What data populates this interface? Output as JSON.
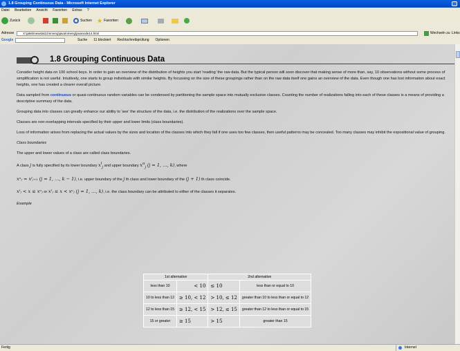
{
  "window": {
    "title": "1.8 Grouping Continuous Data - Microsoft Internet Explorer"
  },
  "menu": [
    "Datei",
    "Bearbeiten",
    "Ansicht",
    "Favoriten",
    "Extras",
    "?"
  ],
  "toolbar": {
    "back": "Zurück",
    "search": "Suchen",
    "favorites": "Favoriten"
  },
  "address": {
    "label": "Adresse",
    "url": "X:\\jaleb\\newstat11\\nmeng\\java\\nmeng\\javanode14.html",
    "go": "Wechseln zu",
    "links": "Links"
  },
  "google": {
    "logo": "Google",
    "search": "Suche",
    "blocked": "11 blockiert",
    "spell": "Rechtschreibprüfung",
    "options": "Optionen"
  },
  "page": {
    "title": "1.8 Grouping Continuous Data",
    "para1": "Consider height data on 100 school boys. In order to gain an overview of the distribution of heights you start 'reading' the raw data. But the typical person will soon discover that making sense of more than, say, 10 observations without some process of simplification is not useful. Intuitively, one starts to group individuals with similar heights. By focussing on the size of these groupings rather than on the raw data itself one gains an overview of the data. Even though one has lost information about exact heights, one has created a clearer overall picture.",
    "para2_pre": "Data sampled from ",
    "para2_link": "continuous",
    "para2_post": " or quasi-continuous random variables can be condensed by partitioning the sample space into mutually exclusive classes. Counting the number of realizations falling into each of these classes is a means of providing a descriptive summary of the data.",
    "para3": "Grouping data into classes can greatly enhance our ability to 'see' the structure of the data, i.e. the distribution of the realizations over the sample space.",
    "para4": "Classes are non-overlapping intervals specified by their upper and lower limits (class boundaries).",
    "para5": "Loss of information arises from replacing the actual values by the sizes and location of the classes into which they fall if one uses too few classes, then useful patterns may be concealed. Too many classes may inhibit the expositional value of grouping.",
    "heading_boundaries": "Class boundaries",
    "para6": "The upper and lower values of a class are called class boundaries.",
    "para7_a": "A class ",
    "para7_j": "j",
    "para7_b": " is fully specified by its lower boundary ",
    "para7_xl": "x",
    "para7_c": " and upper boundary ",
    "para7_xu": "x",
    "para7_range": "(j = 1, …, k)",
    "para7_d": ", where",
    "eq1_math": "xᵘⱼ = xˡⱼ₊₁   (j = 1, …, k − 1)",
    "eq1_text": ", i.e. upper boundary of the ",
    "eq1_j": "j",
    "eq1_text2": " th class and lower boundary of the ",
    "eq1_j1": "(j + 1)",
    "eq1_text3": " th class coincide.",
    "eq2_math1": "xˡⱼ < x ≤ xᵘⱼ",
    "eq2_or": " or ",
    "eq2_math2": "xˡⱼ ≤ x < xᵘⱼ   (j = 1, …, k)",
    "eq2_text": ", i.e. the class boundary can be attributed to either of the classes it separates.",
    "heading_example": "Example"
  },
  "table": {
    "head1": "1st alternative",
    "head2": "2nd alternative",
    "rows": [
      [
        "less than 10",
        "< 10",
        "≤ 10",
        "less than or equal to 10"
      ],
      [
        "10 to less than 12",
        "≥ 10, < 12",
        "> 10, ≤ 12",
        "greater than 10 to less than or equal to 12"
      ],
      [
        "12 to less than 15",
        "≥ 12, < 15",
        "> 12, ≤ 15",
        "greater than 12 to less than or equal to 15"
      ],
      [
        "15 or greater",
        "≥ 15",
        "> 15",
        "greater than 15"
      ]
    ]
  },
  "status": {
    "left": "Fertig",
    "zone": "Internet"
  }
}
